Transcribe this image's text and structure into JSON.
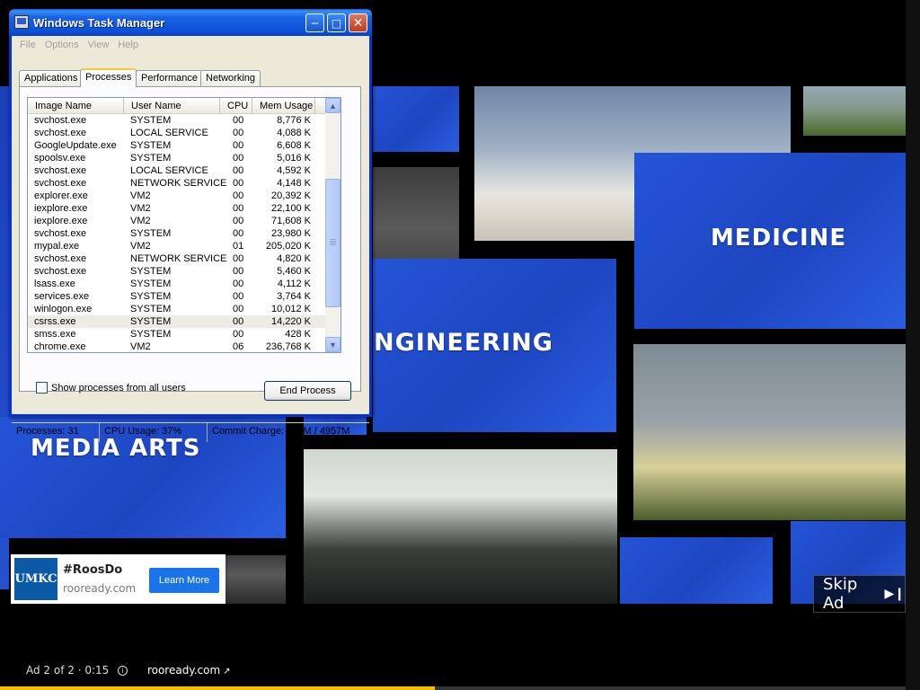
{
  "video": {
    "tiles": {
      "medicine": "MEDICINE",
      "engineering": "NGINEERING",
      "media_arts": "MEDIA ARTS"
    }
  },
  "ad": {
    "logo": "UMKC",
    "title": "#RoosDo",
    "domain": "rooready.com",
    "cta": "Learn More",
    "skip_label": "Skip Ad",
    "info_text": "Ad 2 of 2 · 0:15",
    "link": "rooready.com",
    "progress_fraction": 0.48
  },
  "task_manager": {
    "title": "Windows Task Manager",
    "menu": [
      "File",
      "Options",
      "View",
      "Help"
    ],
    "tabs": [
      "Applications",
      "Processes",
      "Performance",
      "Networking"
    ],
    "active_tab": "Processes",
    "columns": [
      "Image Name",
      "User Name",
      "CPU",
      "Mem Usage"
    ],
    "processes": [
      {
        "name": "svchost.exe",
        "user": "SYSTEM",
        "cpu": "00",
        "mem": "8,776 K"
      },
      {
        "name": "svchost.exe",
        "user": "LOCAL SERVICE",
        "cpu": "00",
        "mem": "4,088 K"
      },
      {
        "name": "GoogleUpdate.exe",
        "user": "SYSTEM",
        "cpu": "00",
        "mem": "6,608 K"
      },
      {
        "name": "spoolsv.exe",
        "user": "SYSTEM",
        "cpu": "00",
        "mem": "5,016 K"
      },
      {
        "name": "svchost.exe",
        "user": "LOCAL SERVICE",
        "cpu": "00",
        "mem": "4,592 K"
      },
      {
        "name": "svchost.exe",
        "user": "NETWORK SERVICE",
        "cpu": "00",
        "mem": "4,148 K"
      },
      {
        "name": "explorer.exe",
        "user": "VM2",
        "cpu": "00",
        "mem": "20,392 K"
      },
      {
        "name": "iexplore.exe",
        "user": "VM2",
        "cpu": "00",
        "mem": "22,100 K"
      },
      {
        "name": "iexplore.exe",
        "user": "VM2",
        "cpu": "00",
        "mem": "71,608 K"
      },
      {
        "name": "svchost.exe",
        "user": "SYSTEM",
        "cpu": "00",
        "mem": "23,980 K"
      },
      {
        "name": "mypal.exe",
        "user": "VM2",
        "cpu": "01",
        "mem": "205,020 K"
      },
      {
        "name": "svchost.exe",
        "user": "NETWORK SERVICE",
        "cpu": "00",
        "mem": "4,820 K"
      },
      {
        "name": "svchost.exe",
        "user": "SYSTEM",
        "cpu": "00",
        "mem": "5,460 K"
      },
      {
        "name": "lsass.exe",
        "user": "SYSTEM",
        "cpu": "00",
        "mem": "4,112 K"
      },
      {
        "name": "services.exe",
        "user": "SYSTEM",
        "cpu": "00",
        "mem": "3,764 K"
      },
      {
        "name": "winlogon.exe",
        "user": "SYSTEM",
        "cpu": "00",
        "mem": "10,012 K"
      },
      {
        "name": "csrss.exe",
        "user": "SYSTEM",
        "cpu": "00",
        "mem": "14,220 K",
        "selected": true
      },
      {
        "name": "smss.exe",
        "user": "SYSTEM",
        "cpu": "00",
        "mem": "428 K"
      },
      {
        "name": "chrome.exe",
        "user": "VM2",
        "cpu": "06",
        "mem": "236,768 K"
      }
    ],
    "show_all_label": "Show processes from all users",
    "end_process_label": "End Process",
    "status": {
      "processes": "Processes: 31",
      "cpu": "CPU Usage: 37%",
      "commit": "Commit Charge: 917M / 4957M"
    }
  }
}
